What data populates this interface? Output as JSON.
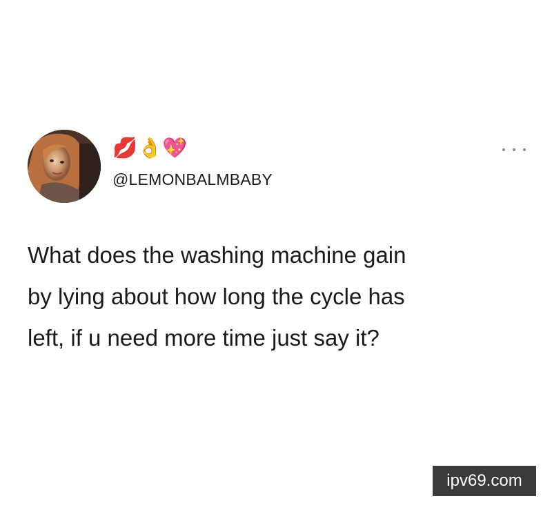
{
  "tweet": {
    "display_name_emoji": "💋👌💖",
    "handle": "@LEMONBALMBABY",
    "text": "What does the washing machine gain\nby lying about how long the cycle has\nleft, if u need more time just say it?"
  },
  "more_menu_icon": "ellipsis-icon",
  "watermark": {
    "text": "ipv69.com"
  },
  "colors": {
    "background": "#ffffff",
    "text": "#1a1a1a",
    "watermark_bg": "#3b3b3b"
  }
}
